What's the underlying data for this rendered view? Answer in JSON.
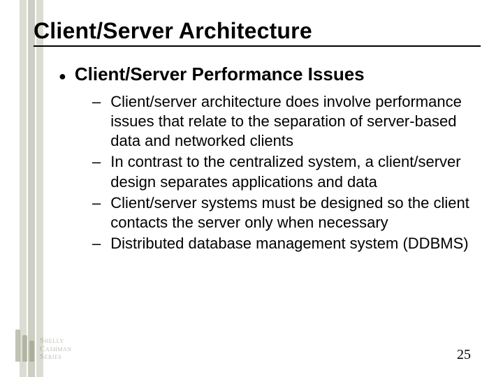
{
  "title": "Client/Server Architecture",
  "bullet": {
    "marker": "●",
    "heading": "Client/Server Performance Issues",
    "items": [
      "Client/server architecture does involve performance issues that relate to the separation of server-based data and networked clients",
      "In contrast to the centralized system, a client/server design separates applications and data",
      "Client/server systems must be designed so the client contacts the server only when necessary",
      "Distributed database management system (DDBMS)"
    ]
  },
  "page_number": "25",
  "brand": {
    "line1": "Shelly",
    "line2": "Cashman",
    "line3": "Series"
  },
  "dash": "–"
}
